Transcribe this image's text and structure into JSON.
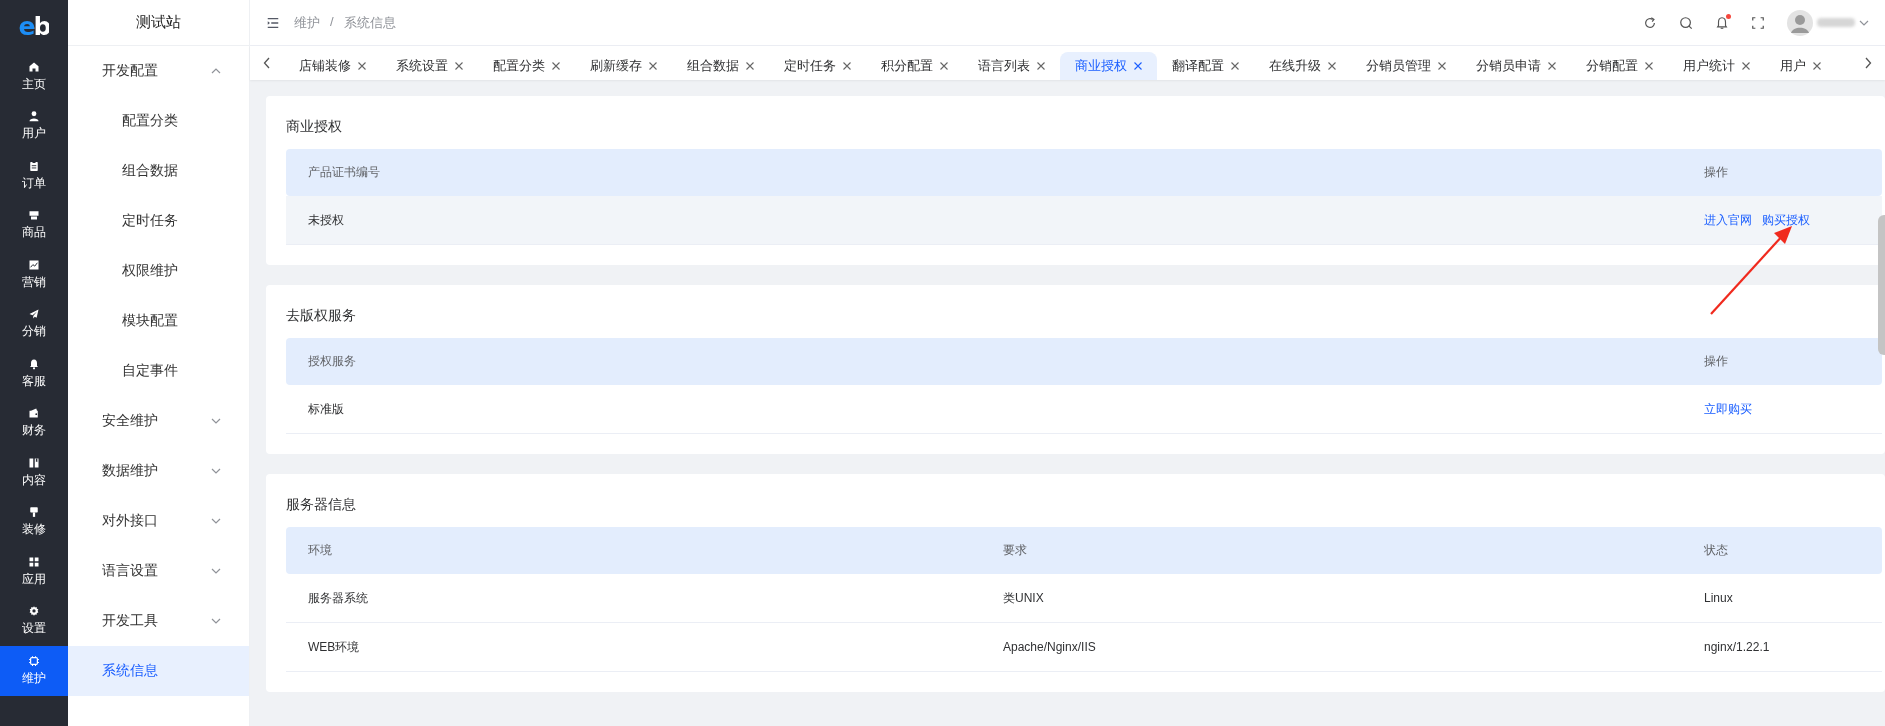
{
  "rail": {
    "logo": "eb",
    "items": [
      {
        "label": "主页",
        "selected": false
      },
      {
        "label": "用户",
        "selected": false
      },
      {
        "label": "订单",
        "selected": false
      },
      {
        "label": "商品",
        "selected": false
      },
      {
        "label": "营销",
        "selected": false
      },
      {
        "label": "分销",
        "selected": false
      },
      {
        "label": "客服",
        "selected": false
      },
      {
        "label": "财务",
        "selected": false
      },
      {
        "label": "内容",
        "selected": false
      },
      {
        "label": "装修",
        "selected": false
      },
      {
        "label": "应用",
        "selected": false
      },
      {
        "label": "设置",
        "selected": false
      },
      {
        "label": "维护",
        "selected": true
      }
    ]
  },
  "sidebar": {
    "title": "测试站",
    "items": [
      {
        "kind": "group",
        "label": "开发配置",
        "expanded": true,
        "children": [
          {
            "label": "配置分类",
            "selected": false
          },
          {
            "label": "组合数据",
            "selected": false
          },
          {
            "label": "定时任务",
            "selected": false
          },
          {
            "label": "权限维护",
            "selected": false
          },
          {
            "label": "模块配置",
            "selected": false
          },
          {
            "label": "自定事件",
            "selected": false
          }
        ]
      },
      {
        "kind": "group",
        "label": "安全维护",
        "expanded": false
      },
      {
        "kind": "group",
        "label": "数据维护",
        "expanded": false
      },
      {
        "kind": "group",
        "label": "对外接口",
        "expanded": false
      },
      {
        "kind": "group",
        "label": "语言设置",
        "expanded": false
      },
      {
        "kind": "group",
        "label": "开发工具",
        "expanded": false
      },
      {
        "kind": "leaf",
        "label": "系统信息",
        "selected": true
      }
    ]
  },
  "header": {
    "breadcrumb": [
      "维护",
      "系统信息"
    ],
    "breadcrumb_separator": "/",
    "notification_dot": true
  },
  "tabs": [
    {
      "label": "店铺装修",
      "selected": false
    },
    {
      "label": "系统设置",
      "selected": false
    },
    {
      "label": "配置分类",
      "selected": false
    },
    {
      "label": "刷新缓存",
      "selected": false
    },
    {
      "label": "组合数据",
      "selected": false
    },
    {
      "label": "定时任务",
      "selected": false
    },
    {
      "label": "积分配置",
      "selected": false
    },
    {
      "label": "语言列表",
      "selected": false
    },
    {
      "label": "商业授权",
      "selected": true
    },
    {
      "label": "翻译配置",
      "selected": false
    },
    {
      "label": "在线升级",
      "selected": false
    },
    {
      "label": "分销员管理",
      "selected": false
    },
    {
      "label": "分销员申请",
      "selected": false
    },
    {
      "label": "分销配置",
      "selected": false
    },
    {
      "label": "用户统计",
      "selected": false
    },
    {
      "label": "用户",
      "selected": false
    }
  ],
  "sections": [
    {
      "title": "商业授权",
      "columns": [
        "产品证书编号",
        "操作"
      ],
      "rows": [
        {
          "highlighted": true,
          "cells": [
            {
              "kind": "text",
              "text": "未授权"
            },
            {
              "kind": "links",
              "links": [
                "进入官网",
                "购买授权"
              ]
            }
          ]
        }
      ]
    },
    {
      "title": "去版权服务",
      "columns": [
        "授权服务",
        "操作"
      ],
      "rows": [
        {
          "highlighted": false,
          "cells": [
            {
              "kind": "text",
              "text": "标准版"
            },
            {
              "kind": "links",
              "links": [
                "立即购买"
              ]
            }
          ]
        }
      ]
    },
    {
      "title": "服务器信息",
      "columns": [
        "环境",
        "要求",
        "状态"
      ],
      "rows": [
        {
          "highlighted": false,
          "cells": [
            {
              "kind": "text",
              "text": "服务器系统"
            },
            {
              "kind": "text",
              "text": "类UNIX"
            },
            {
              "kind": "text",
              "text": "Linux"
            }
          ]
        },
        {
          "highlighted": false,
          "cells": [
            {
              "kind": "text",
              "text": "WEB环境"
            },
            {
              "kind": "text",
              "text": "Apache/Nginx/IIS"
            },
            {
              "kind": "text",
              "text": "nginx/1.22.1"
            }
          ]
        }
      ]
    }
  ]
}
